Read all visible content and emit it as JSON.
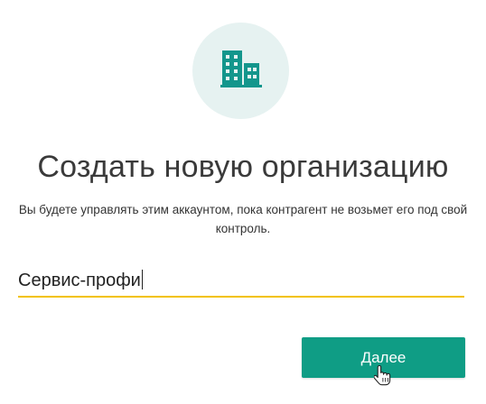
{
  "header": {
    "icon": "building-icon",
    "icon_color": "#13968c",
    "icon_bg_color": "#e6f2f1"
  },
  "title": "Создать новую организацию",
  "subtitle": "Вы будете управлять этим аккаунтом, пока контрагент не возьмет его под свой контроль.",
  "org_name_field": {
    "value": "Сервис-профи",
    "underline_color": "#f2c200"
  },
  "next_button": {
    "label": "Далее",
    "color": "#0f9d85"
  },
  "pointer": "hand-pointer-icon"
}
